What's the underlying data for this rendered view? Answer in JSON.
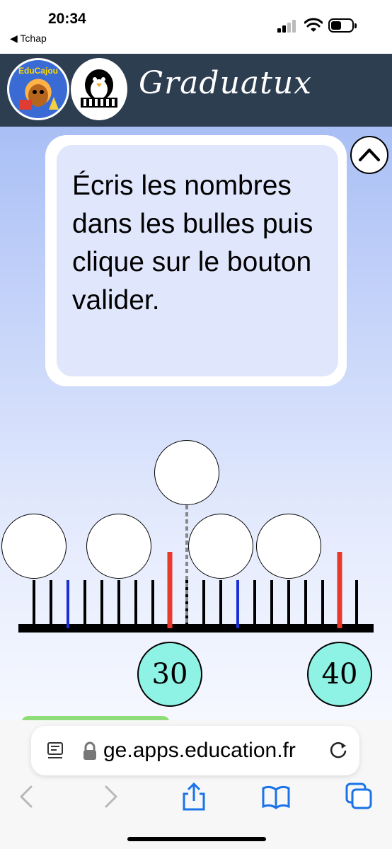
{
  "status_bar": {
    "time": "20:34",
    "back_app": "◀ Tchap"
  },
  "app": {
    "title": "Graduatux",
    "logo_text": "EduCajou"
  },
  "instructions": {
    "text": "Écris les nombres dans les bulles puis clique sur le bouton valider."
  },
  "number_line": {
    "labels": [
      {
        "value": "30",
        "tick": 8
      },
      {
        "value": "40",
        "tick": 18
      }
    ],
    "bubbles": [
      {
        "tick": 0,
        "raised": false,
        "value": ""
      },
      {
        "tick": 5,
        "raised": false,
        "value": ""
      },
      {
        "tick": 9,
        "raised": true,
        "value": ""
      },
      {
        "tick": 11,
        "raised": false,
        "value": ""
      },
      {
        "tick": 15,
        "raised": false,
        "value": ""
      }
    ],
    "tick_count": 20,
    "red_ticks": [
      8,
      18
    ],
    "blue_ticks": [
      2,
      12
    ],
    "colors": {
      "red": "#e8392a",
      "blue": "#1a2ed6",
      "black": "#000000",
      "badge": "#8ef2e4"
    }
  },
  "browser": {
    "url": "ge.apps.education.fr"
  }
}
